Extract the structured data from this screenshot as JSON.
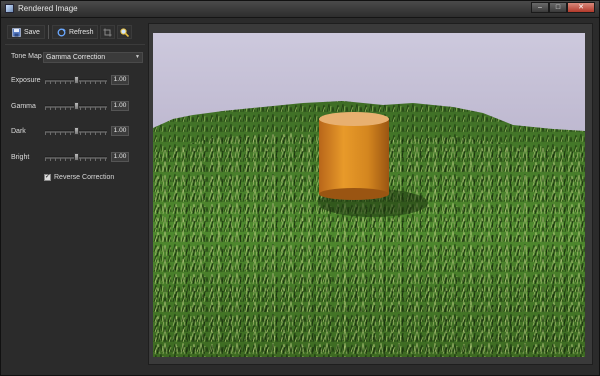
{
  "window": {
    "title": "Rendered Image",
    "controls": {
      "minimize": "–",
      "maximize": "□",
      "close": "✕"
    }
  },
  "toolbar": {
    "save_label": "Save",
    "refresh_label": "Refresh",
    "icons": [
      "save-icon",
      "refresh-icon",
      "crop-icon",
      "zoom-icon"
    ]
  },
  "controls": {
    "tonemap": {
      "label": "Tone Map",
      "value": "Gamma Correction"
    },
    "exposure": {
      "label": "Exposure",
      "value": "1.00",
      "level": 0.5
    },
    "gamma": {
      "label": "Gamma",
      "value": "1.00",
      "level": 0.5
    },
    "dark": {
      "label": "Dark",
      "value": "1.00",
      "level": 0.5
    },
    "bright": {
      "label": "Bright",
      "value": "1.00",
      "level": 0.5
    },
    "reverse_correction": {
      "label": "Reverse Correction",
      "checked": true
    }
  },
  "colors": {
    "sky": "#c8c4d8",
    "grass": "#4e8a2c",
    "cylinder": "#d88a20",
    "panel": "#2b2b2b"
  }
}
